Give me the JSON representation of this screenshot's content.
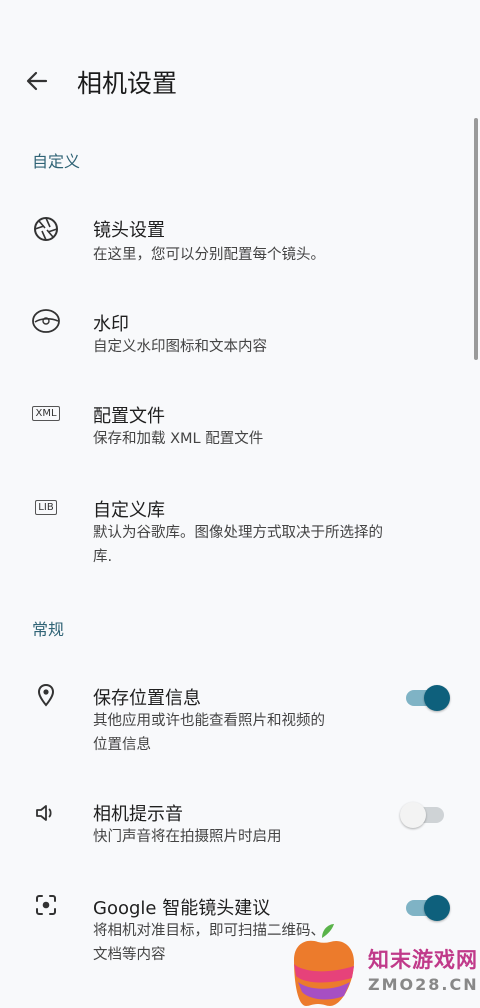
{
  "header": {
    "title": "相机设置"
  },
  "sections": {
    "custom": "自定义",
    "general": "常规"
  },
  "items": {
    "lens": {
      "label": "镜头设置",
      "sub": "在这里，您可以分别配置每个镜头。",
      "icon": "aperture-icon"
    },
    "watermark": {
      "label": "水印",
      "sub": "自定义水印图标和文本内容",
      "icon": "watermark-icon"
    },
    "config": {
      "label": "配置文件",
      "sub": "保存和加载 XML 配置文件",
      "icon": "xml-icon",
      "badge": "XML"
    },
    "library": {
      "label": "自定义库",
      "sub1": "默认为谷歌库。图像处理方式取决于所选择的",
      "sub2": "库.",
      "icon": "lib-icon",
      "badge": "LIB"
    },
    "location": {
      "label": "保存位置信息",
      "sub1": "其他应用或许也能查看照片和视频的",
      "sub2": "位置信息",
      "icon": "location-pin-icon",
      "enabled": true
    },
    "sound": {
      "label": "相机提示音",
      "sub": "快门声音将在拍摄照片时启用",
      "icon": "speaker-icon",
      "enabled": false
    },
    "lens_suggest": {
      "label": "Google 智能镜头建议",
      "sub1": "将相机对准目标，即可扫描二维码、",
      "sub2": "文档等内容",
      "icon": "lens-scan-icon",
      "enabled": true
    }
  },
  "watermark_overlay": {
    "text": "知末游戏网",
    "url": "ZMO28.CN"
  },
  "colors": {
    "accent": "#0e607c",
    "section": "#2f6375",
    "background": "#f8f9fb"
  }
}
